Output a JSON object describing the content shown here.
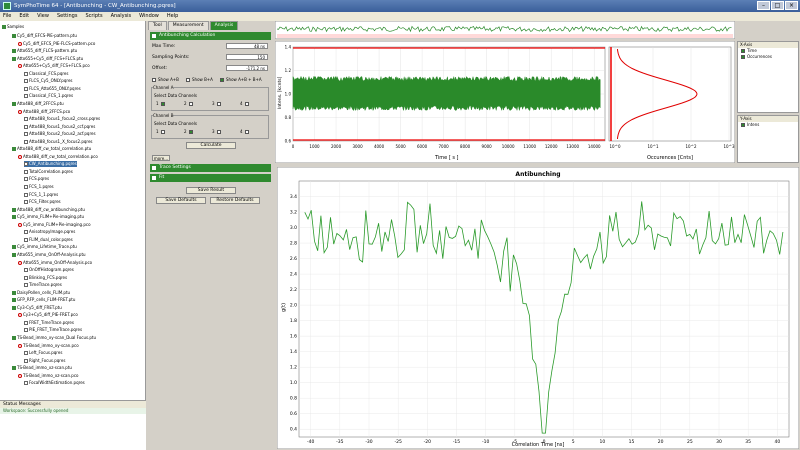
{
  "window": {
    "title": "SymPhoTime 64 - [Antibunching - CW_Antibunching.pqres]"
  },
  "menu": [
    "File",
    "Edit",
    "View",
    "Settings",
    "Scripts",
    "Analysis",
    "Window",
    "Help"
  ],
  "tree": {
    "root": "Samples",
    "items": [
      {
        "label": "Cy5_diff_EFCS-PIE-pattern.ptu",
        "depth": 1,
        "icon": "fold"
      },
      {
        "label": "Cy5_diff_EFCS_PIE-FLCS-pattern.pco",
        "depth": 2,
        "icon": "red"
      },
      {
        "label": "Atto655_diff_FLCS-pattern.ptu",
        "depth": 1,
        "icon": "fold"
      },
      {
        "label": "Atto655+Cy5_diff_FCS+FLCS.ptu",
        "depth": 1,
        "icon": "fold"
      },
      {
        "label": "Atto655+Cy5_diff_FCS+FLCS.pco",
        "depth": 2,
        "icon": "red"
      },
      {
        "label": "Classical_FCS.pqres",
        "depth": 3,
        "icon": "file"
      },
      {
        "label": "FLCS_Cy5_ONLY.pqres",
        "depth": 3,
        "icon": "file"
      },
      {
        "label": "FLCS_Atto655_ONLY.pqres",
        "depth": 3,
        "icon": "file"
      },
      {
        "label": "Classical_FCS_1.pqres",
        "depth": 3,
        "icon": "file"
      },
      {
        "label": "Atto488_diff_2FFCS.ptu",
        "depth": 1,
        "icon": "fold"
      },
      {
        "label": "Atto488_diff_2FFCS.pco",
        "depth": 2,
        "icon": "red"
      },
      {
        "label": "Atto488_focus1_focus2_cross.pqres",
        "depth": 3,
        "icon": "file"
      },
      {
        "label": "Atto488_focus1_focus2_ccf.pqres",
        "depth": 3,
        "icon": "file"
      },
      {
        "label": "Atto488_focus2_focus2_acf.pqres",
        "depth": 3,
        "icon": "file"
      },
      {
        "label": "Atto488_focus1_X_focus2.pqres",
        "depth": 3,
        "icon": "file"
      },
      {
        "label": "Atto488_diff_cw_total_correlation.ptu",
        "depth": 1,
        "icon": "fold"
      },
      {
        "label": "Atto488_diff_cw_total_correlation.pco",
        "depth": 2,
        "icon": "red"
      },
      {
        "label": "CW_Antibunching.pqres",
        "depth": 3,
        "icon": "file",
        "selected": true
      },
      {
        "label": "TotalCorrelation.pqres",
        "depth": 3,
        "icon": "file"
      },
      {
        "label": "FCS.pqres",
        "depth": 3,
        "icon": "file"
      },
      {
        "label": "FCS_1.pqres",
        "depth": 3,
        "icon": "file"
      },
      {
        "label": "FCS_1_1.pqres",
        "depth": 3,
        "icon": "file"
      },
      {
        "label": "FCS_Filter.pqres",
        "depth": 3,
        "icon": "file"
      },
      {
        "label": "Atto488_diff_cw_antibunching.ptu",
        "depth": 1,
        "icon": "fold"
      },
      {
        "label": "Cy5_immo_FLIM+Pie-imaging.ptu",
        "depth": 1,
        "icon": "fold"
      },
      {
        "label": "Cy5_immo_FLIM+Pie-imaging.pco",
        "depth": 2,
        "icon": "red"
      },
      {
        "label": "Anisotropylmage.pqres",
        "depth": 3,
        "icon": "file"
      },
      {
        "label": "FLIM_dual_color.pqres",
        "depth": 3,
        "icon": "file"
      },
      {
        "label": "Cy5_immo_Lifetime_Trace.ptu",
        "depth": 1,
        "icon": "fold"
      },
      {
        "label": "Atto655_immo_OnOff-Analysis.ptu",
        "depth": 1,
        "icon": "fold"
      },
      {
        "label": "Atto655_immo_OnOff-Analysis.pco",
        "depth": 2,
        "icon": "red"
      },
      {
        "label": "OnOffHistogram.pqres",
        "depth": 3,
        "icon": "file"
      },
      {
        "label": "Blinking_FCS.pqres",
        "depth": 3,
        "icon": "file"
      },
      {
        "label": "TimeTrace.pqres",
        "depth": 3,
        "icon": "file"
      },
      {
        "label": "DaisyPollen_cells_FLIM.ptu",
        "depth": 1,
        "icon": "fold"
      },
      {
        "label": "GFP_RFP_cells_FLIM-FRET.ptu",
        "depth": 1,
        "icon": "fold"
      },
      {
        "label": "Cy3-Cy5_diff_FRET.ptu",
        "depth": 1,
        "icon": "fold"
      },
      {
        "label": "Cy3+Cy5_diff_PIE-FRET.pco",
        "depth": 2,
        "icon": "red"
      },
      {
        "label": "FRET_TimeTrace.pqres",
        "depth": 3,
        "icon": "file"
      },
      {
        "label": "PIE_FRET_TimeTrace.pqres",
        "depth": 3,
        "icon": "file"
      },
      {
        "label": "TS-Bead_immo_xy-scan_Dual Focus.ptu",
        "depth": 1,
        "icon": "fold"
      },
      {
        "label": "TS-Bead_immo_xy-scan.pco",
        "depth": 2,
        "icon": "red"
      },
      {
        "label": "Left_Focus.pqres",
        "depth": 3,
        "icon": "file"
      },
      {
        "label": "Right_Focus.pqres",
        "depth": 3,
        "icon": "file"
      },
      {
        "label": "TS-Bead_immo_xz-scan.ptu",
        "depth": 1,
        "icon": "fold"
      },
      {
        "label": "TS-Bead_immo_xz-scan.pco",
        "depth": 2,
        "icon": "red"
      },
      {
        "label": "FocalWidthEstimation.pqres",
        "depth": 3,
        "icon": "file"
      }
    ]
  },
  "status": {
    "header": "Status Messages",
    "message": "Workspace: Successfully opened"
  },
  "tabs": [
    "Tool",
    "Measurement",
    "Analysis"
  ],
  "panel": {
    "section_title": "Antibunching Calculation",
    "max_time_label": "Max Time:",
    "max_time_value": "48 ns",
    "sampling_label": "Sampling Points:",
    "sampling_value": "150",
    "offset_label": "Offset:",
    "offset_value": "-171.2 ns",
    "show_a_label": "Show A+B",
    "show_b_label": "Show B+A",
    "show_ab_label": "Show A+B + B+A",
    "channel_a_label": "Channel A",
    "channel_b_label": "Channel B",
    "select_label": "Select Data Channels",
    "ch_numbers": [
      "1",
      "2",
      "3",
      "4"
    ],
    "calculate_label": "Calculate",
    "more_label": "more...",
    "trace_settings": "Trace Settings",
    "fit_label": "Fit",
    "save_result": "Save Result",
    "save_defaults": "Save Defaults",
    "restore_defaults": "Restore Defaults"
  },
  "legend_x": {
    "title": "X-Axis",
    "items": [
      "Time",
      "Occurrences"
    ]
  },
  "legend_y": {
    "title": "Y-Axis",
    "items": [
      "Intens"
    ]
  },
  "trace_axes": {
    "xlabel": "Time [ s ]",
    "ylabel": "Intens. [kcnts]",
    "hist_xlabel": "Occurences [Cnts]"
  },
  "chart_data": [
    {
      "type": "line",
      "title": "",
      "xlabel": "Time [ s ]",
      "ylabel": "Intens. [kcnts]",
      "xlim": [
        0,
        14500
      ],
      "ylim": [
        0.6,
        1.4
      ],
      "x_ticks": [
        0,
        1000,
        2000,
        3000,
        4000,
        5000,
        6000,
        7000,
        8000,
        9000,
        10000,
        11000,
        12000,
        13000,
        14000
      ],
      "y_ticks": [
        0.6,
        0.8,
        1.0,
        1.2,
        1.4
      ],
      "series": [
        {
          "color": "#2a8a2a",
          "mean": 1.0,
          "band": [
            0.86,
            1.15
          ]
        }
      ]
    },
    {
      "type": "line",
      "title": "",
      "xlabel": "Occurences [Cnts]",
      "x_ticks": [
        "10^0",
        "10^1",
        "10^2",
        "10^3"
      ],
      "series": [
        {
          "color": "#e00000"
        }
      ]
    },
    {
      "type": "line",
      "title": "Antibunching",
      "xlabel": "Correlation Time [ns]",
      "ylabel": "g(t)",
      "xlim": [
        -42,
        42
      ],
      "ylim": [
        0.3,
        3.6
      ],
      "x_ticks": [
        -40,
        -35,
        -30,
        -25,
        -20,
        -15,
        -10,
        -5,
        0,
        5,
        10,
        15,
        20,
        25,
        30,
        35,
        40
      ],
      "y_ticks": [
        0.4,
        0.6,
        0.8,
        1.0,
        1.2,
        1.4,
        1.6,
        1.8,
        2.0,
        2.2,
        2.4,
        2.6,
        2.8,
        3.0,
        3.2,
        3.4
      ],
      "series": [
        {
          "color": "#2a9a2a",
          "baseline": 2.95,
          "minimum": 0.35,
          "min_at": 0
        }
      ]
    }
  ],
  "colors": {
    "accent": "#2f8a2f",
    "trace": "#2a8a2a",
    "histogram": "#e00000",
    "selection": "#3a6ea5"
  }
}
